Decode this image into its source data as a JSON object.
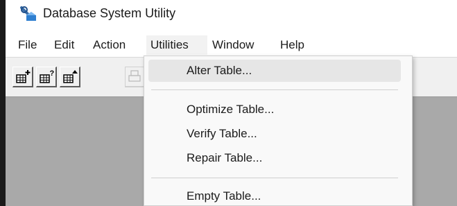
{
  "window": {
    "title": "Database System Utility",
    "icon": "magnifier-database-icon"
  },
  "menubar": {
    "items": [
      {
        "label": "File"
      },
      {
        "label": "Edit"
      },
      {
        "label": "Action"
      },
      {
        "label": "Utilities",
        "open": true
      },
      {
        "label": "Window"
      },
      {
        "label": "Help"
      }
    ]
  },
  "toolbar": {
    "buttons": [
      {
        "icon": "table-add-icon"
      },
      {
        "icon": "table-query-icon"
      },
      {
        "icon": "table-up-icon"
      },
      {
        "icon": "print-icon",
        "disabled": true
      }
    ]
  },
  "utilities_menu": {
    "items": [
      {
        "label": "Alter Table...",
        "highlighted": true
      },
      {
        "label": "Optimize Table..."
      },
      {
        "label": "Verify Table..."
      },
      {
        "label": "Repair Table..."
      },
      {
        "label": "Empty Table..."
      }
    ]
  },
  "colors": {
    "client_background": "#a9a9a9",
    "menu_background": "#f9f9f9",
    "menu_highlight": "#e6e6e6",
    "toolbar_background": "#f0f0f0"
  }
}
